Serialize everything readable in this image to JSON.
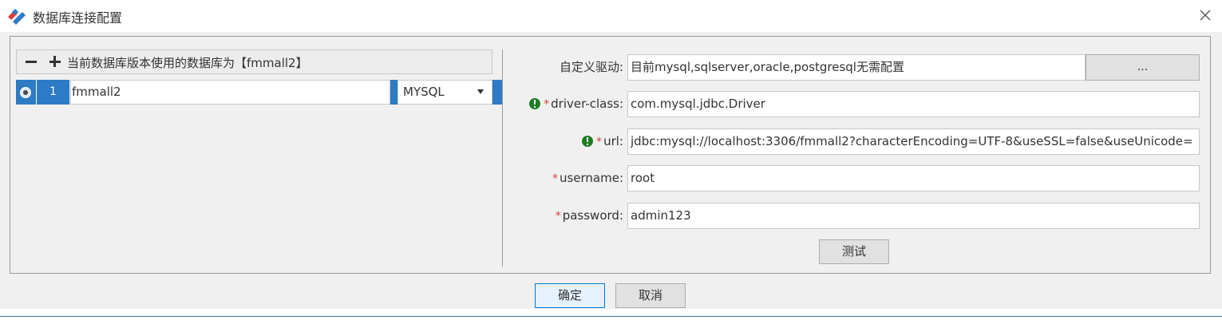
{
  "window": {
    "title": "数据库连接配置",
    "logo_icon": "app-logo-icon",
    "close_icon": "close-icon",
    "brand_colors": [
      "#e4393c",
      "#2c7bc4"
    ]
  },
  "left_panel": {
    "toolbar": {
      "remove_icon": "minus-icon",
      "add_icon": "plus-icon",
      "label": "当前数据库版本使用的数据库为【fmmall2】"
    },
    "rows": [
      {
        "selected": true,
        "index": "1",
        "name": "fmmall2",
        "db_type": "MYSQL"
      }
    ],
    "selection_color": "#2c7bc4"
  },
  "form": {
    "driver": {
      "label": "自定义驱动:",
      "value": "目前mysql,sqlserver,oracle,postgresql无需配置",
      "browse_label": "..."
    },
    "driver_class": {
      "label": "driver-class:",
      "required_mark": "*",
      "has_warning": true,
      "value": "com.mysql.jdbc.Driver"
    },
    "url": {
      "label": "url:",
      "required_mark": "*",
      "has_warning": true,
      "value": "jdbc:mysql://localhost:3306/fmmall2?characterEncoding=UTF-8&useSSL=false&useUnicode="
    },
    "username": {
      "label": "username:",
      "required_mark": "*",
      "value": "root"
    },
    "password": {
      "label": "password:",
      "required_mark": "*",
      "value": "admin123"
    },
    "test_label": "测试",
    "warning_icon": "exclamation-circle-icon",
    "warning_color": "#1e7d22",
    "required_color": "#d43f3a"
  },
  "footer": {
    "ok_label": "确定",
    "cancel_label": "取消"
  }
}
